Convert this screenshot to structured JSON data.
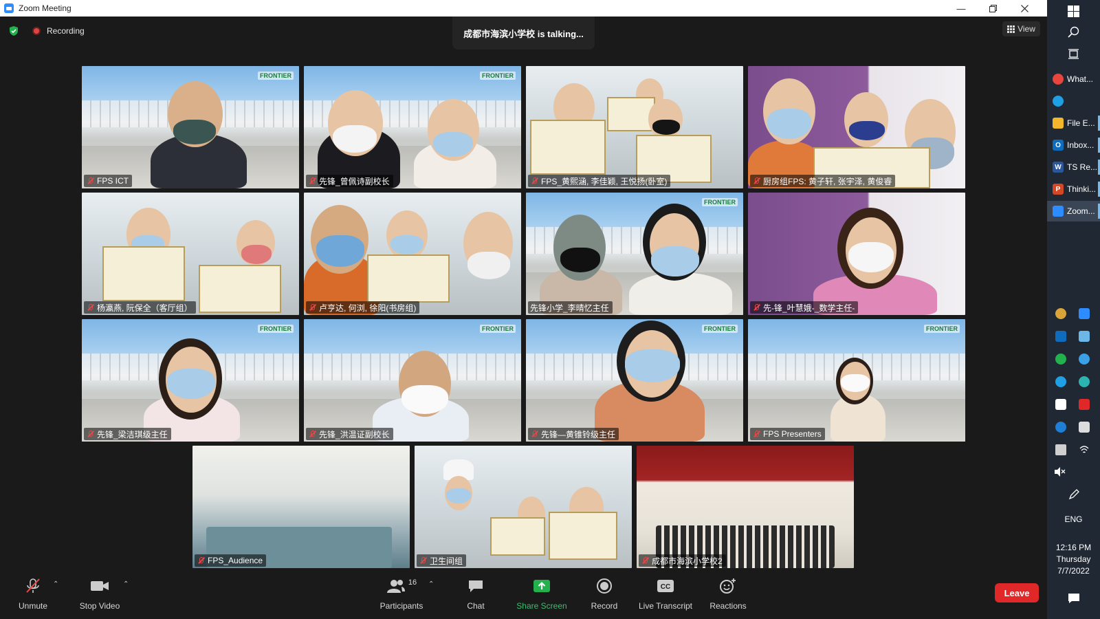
{
  "window": {
    "title": "Zoom Meeting"
  },
  "meeting": {
    "recording_label": "Recording",
    "talking_text": "成都市海滨小学校 is talking...",
    "view_label": "View"
  },
  "tiles": [
    {
      "name": "FPS ICT",
      "muted": true
    },
    {
      "name": "先锋_曾佩诗副校长",
      "muted": true
    },
    {
      "name": "FPS_黄熙涵, 李佳颖, 王悦扬(卧室)",
      "muted": true
    },
    {
      "name": "厨房组FPS: 黄子轩, 张宇泽, 黄俊睿",
      "muted": true
    },
    {
      "name": "杨瀛燕, 阮保全（客厅组）",
      "muted": true
    },
    {
      "name": "卢亨达, 何浏, 徐阳(书房组)",
      "muted": true
    },
    {
      "name": "先锋小学_李晴忆主任",
      "muted": false
    },
    {
      "name": "先-锋_叶慧娥-_数学主任-",
      "muted": true
    },
    {
      "name": "先锋_梁洁琪级主任",
      "muted": true
    },
    {
      "name": "先锋_洪温证副校长",
      "muted": true
    },
    {
      "name": "先锋—黄锥铃级主任",
      "muted": true
    },
    {
      "name": "FPS Presenters",
      "muted": true
    },
    {
      "name": "FPS_Audience",
      "muted": true
    },
    {
      "name": "卫生间组",
      "muted": true
    },
    {
      "name": "成都市海滨小学校2",
      "muted": true
    }
  ],
  "toolbar": {
    "unmute": "Unmute",
    "stop_video": "Stop Video",
    "participants": "Participants",
    "participants_count": "16",
    "chat": "Chat",
    "share_screen": "Share Screen",
    "record": "Record",
    "live_transcript": "Live Transcript",
    "reactions": "Reactions",
    "leave": "Leave",
    "cc_text": "CC"
  },
  "taskbar": {
    "apps": [
      {
        "label": "What...",
        "icon": "chrome-icon",
        "color": "#e8453c"
      },
      {
        "label": "",
        "icon": "edge-icon",
        "color": "#1fa0e5"
      },
      {
        "label": "File E...",
        "icon": "folder-icon",
        "color": "#f2b72a"
      },
      {
        "label": "Inbox...",
        "icon": "outlook-icon",
        "color": "#0f6cbd"
      },
      {
        "label": "TS Re...",
        "icon": "word-icon",
        "color": "#2b579a"
      },
      {
        "label": "Thinki...",
        "icon": "powerpoint-icon",
        "color": "#d24726"
      },
      {
        "label": "Zoom...",
        "icon": "zoom-icon",
        "color": "#2D8CFF"
      }
    ],
    "app_letters": [
      "",
      "",
      "",
      "O",
      "W",
      "P",
      ""
    ],
    "language": "ENG",
    "time": "12:16 PM",
    "day": "Thursday",
    "date": "7/7/2022"
  }
}
